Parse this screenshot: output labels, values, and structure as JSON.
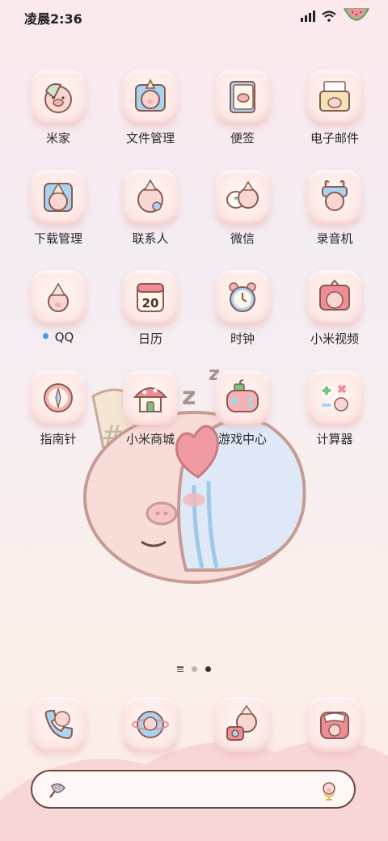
{
  "status_bar": {
    "time": "凌晨2:36"
  },
  "apps": [
    {
      "label": "米家",
      "icon": "mijia-icon"
    },
    {
      "label": "文件管理",
      "icon": "file-manager-icon"
    },
    {
      "label": "便签",
      "icon": "notes-icon"
    },
    {
      "label": "电子邮件",
      "icon": "email-icon"
    },
    {
      "label": "下载管理",
      "icon": "download-manager-icon"
    },
    {
      "label": "联系人",
      "icon": "contacts-icon"
    },
    {
      "label": "微信",
      "icon": "wechat-icon"
    },
    {
      "label": "录音机",
      "icon": "recorder-icon"
    },
    {
      "label": "QQ",
      "icon": "qq-icon",
      "notification_dot": true
    },
    {
      "label": "日历",
      "icon": "calendar-icon",
      "icon_text": "20"
    },
    {
      "label": "时钟",
      "icon": "clock-icon"
    },
    {
      "label": "小米视频",
      "icon": "video-icon"
    },
    {
      "label": "指南针",
      "icon": "compass-icon"
    },
    {
      "label": "小米商城",
      "icon": "mi-store-icon"
    },
    {
      "label": "游戏中心",
      "icon": "game-center-icon"
    },
    {
      "label": "计算器",
      "icon": "calculator-icon"
    }
  ],
  "dock": [
    {
      "icon": "phone-icon"
    },
    {
      "icon": "browser-icon"
    },
    {
      "icon": "camera-icon"
    },
    {
      "icon": "messages-icon"
    }
  ],
  "page_indicator": {
    "pages": 2,
    "active": 2
  },
  "colors": {
    "dot": "#3a9be8",
    "search_border": "#6b4b44"
  }
}
